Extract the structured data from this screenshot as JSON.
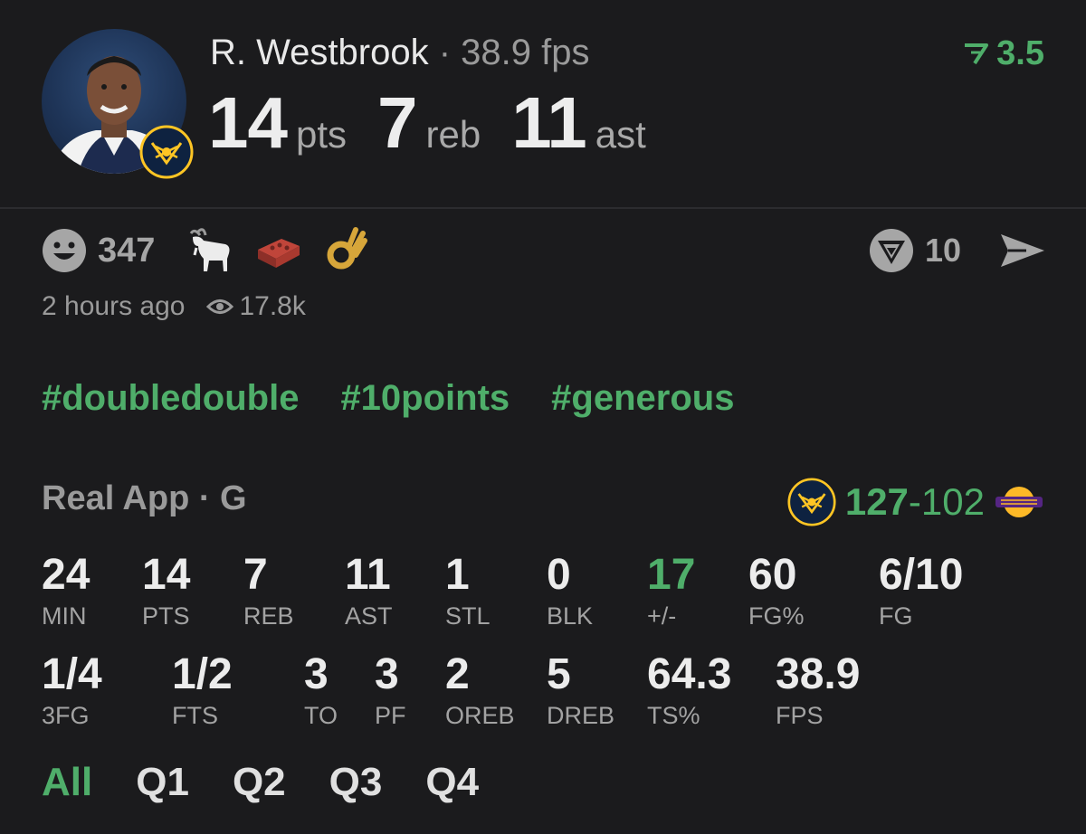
{
  "player": {
    "name": "R. Westbrook",
    "separator": "·",
    "fps_label": "38.9 fps",
    "rank_value": "3.5",
    "headline": [
      {
        "value": "14",
        "unit": "pts"
      },
      {
        "value": "7",
        "unit": "reb"
      },
      {
        "value": "11",
        "unit": "ast"
      }
    ]
  },
  "reactions": {
    "smiley_count": "347",
    "tag_count": "10"
  },
  "meta": {
    "time_ago": "2 hours ago",
    "views": "17.8k"
  },
  "hashtags": [
    "#doubledouble",
    "#10points",
    "#generous"
  ],
  "game": {
    "source": "Real App · G",
    "home_score": "127",
    "dash": "-",
    "away_score": "102"
  },
  "stats_row1": [
    {
      "value": "24",
      "label": "MIN"
    },
    {
      "value": "14",
      "label": "PTS"
    },
    {
      "value": "7",
      "label": "REB"
    },
    {
      "value": "11",
      "label": "AST"
    },
    {
      "value": "1",
      "label": "STL"
    },
    {
      "value": "0",
      "label": "BLK"
    },
    {
      "value": "17",
      "label": "+/-"
    },
    {
      "value": "60",
      "label": "FG%"
    },
    {
      "value": "6/10",
      "label": "FG"
    }
  ],
  "stats_row2": [
    {
      "value": "1/4",
      "label": "3FG"
    },
    {
      "value": "1/2",
      "label": "FTS"
    },
    {
      "value": "3",
      "label": "TO"
    },
    {
      "value": "3",
      "label": "PF"
    },
    {
      "value": "2",
      "label": "OREB"
    },
    {
      "value": "5",
      "label": "DREB"
    },
    {
      "value": "64.3",
      "label": "TS%"
    },
    {
      "value": "38.9",
      "label": "FPS"
    }
  ],
  "tabs": [
    "All",
    "Q1",
    "Q2",
    "Q3",
    "Q4"
  ],
  "colors": {
    "background": "#1b1b1d",
    "accent_green": "#4fae6a",
    "muted": "#9a9a9a"
  }
}
